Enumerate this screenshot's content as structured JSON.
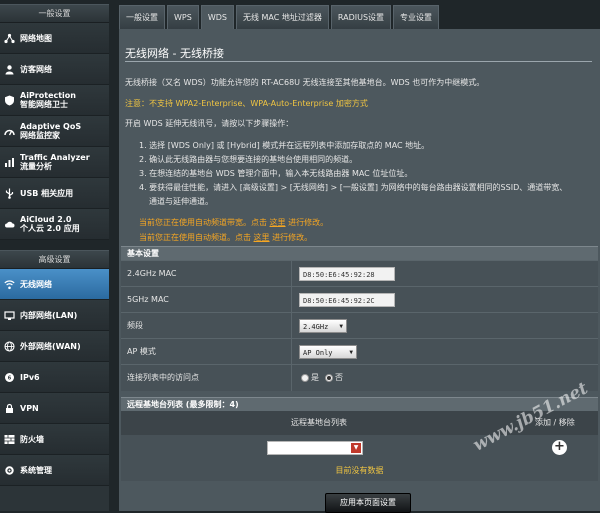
{
  "sidebar": {
    "group1_title": "一般设置",
    "group1": [
      {
        "icon": "network-map-icon",
        "l1": "网络地图",
        "l2": ""
      },
      {
        "icon": "guest-network-icon",
        "l1": "访客网络",
        "l2": ""
      },
      {
        "icon": "aiprotection-icon",
        "l1": "AiProtection",
        "l2": "智能网络卫士"
      },
      {
        "icon": "qos-icon",
        "l1": "Adaptive QoS",
        "l2": "网络监控家"
      },
      {
        "icon": "traffic-analyzer-icon",
        "l1": "Traffic Analyzer",
        "l2": "流量分析"
      },
      {
        "icon": "usb-icon",
        "l1": "USB 相关应用",
        "l2": ""
      },
      {
        "icon": "aicloud-icon",
        "l1": "AiCloud 2.0",
        "l2": "个人云 2.0 应用"
      }
    ],
    "group2_title": "高级设置",
    "group2": [
      {
        "icon": "wireless-icon",
        "l1": "无线网络",
        "active": true
      },
      {
        "icon": "lan-icon",
        "l1": "内部网络(LAN)"
      },
      {
        "icon": "wan-icon",
        "l1": "外部网络(WAN)"
      },
      {
        "icon": "ipv6-icon",
        "l1": "IPv6"
      },
      {
        "icon": "vpn-icon",
        "l1": "VPN"
      },
      {
        "icon": "firewall-icon",
        "l1": "防火墙"
      },
      {
        "icon": "admin-icon",
        "l1": "系统管理"
      }
    ]
  },
  "tabs": [
    "一般设置",
    "WPS",
    "WDS",
    "无线 MAC 地址过滤器",
    "RADIUS设置",
    "专业设置"
  ],
  "page": {
    "title": "无线网络 - 无线桥接",
    "desc": "无线桥接（又名 WDS）功能允许您的 RT-AC68U 无线连接至其他基地台。WDS 也可作为中继模式。",
    "note": "注意：不支持 WPA2-Enterprise、WPA-Auto-Enterprise 加密方式",
    "steps_intro": "开启 WDS 延伸无线讯号，请按以下步骤操作：",
    "steps": [
      "1. 选择 [WDS Only] 或 [Hybrid] 模式并在远程列表中添加存取点的 MAC 地址。",
      "2. 确认此无线路由器与您想要连接的基地台使用相同的频道。",
      "3. 在想连结的基地台 WDS 管理介面中，输入本无线路由器 MAC 位址位址。",
      "4. 要获得最佳性能，请进入 [高级设置] > [无线网络] > [一般设置] 为网络中的每台路由器设置相同的SSID、通道带宽、",
      "   通道与延伸通道。"
    ],
    "link1_pre": "当前您正在使用自动频道带宽。点击",
    "link1_link": "这里",
    "link1_post": "进行修改。",
    "link2_pre": "当前您正在使用自动频道。点击",
    "link2_link": "这里",
    "link2_post": "进行修改。"
  },
  "basic": {
    "title": "基本设置",
    "mac24_label": "2.4GHz MAC",
    "mac24": "D8:50:E6:45:92:28",
    "mac5_label": "5GHz MAC",
    "mac5": "D8:50:E6:45:92:2C",
    "band_label": "频段",
    "band": "2.4GHz",
    "apmode_label": "AP 模式",
    "apmode": "AP Only",
    "access_label": "连接列表中的访问点",
    "yes": "是",
    "no": "否",
    "access_selected": "no"
  },
  "remote": {
    "title": "远程基地台列表 (最多限制：4)",
    "col1": "远程基地台列表",
    "col2": "添加 / 移除",
    "input_value": "",
    "empty": "目前没有数据"
  },
  "apply_label": "应用本页面设置",
  "watermark": "www.jb51.net",
  "colors": {
    "accent_active": "#4a90c8",
    "note": "#f0c542",
    "link": "#f5a623",
    "add_icon_bg": "#ffffff"
  }
}
